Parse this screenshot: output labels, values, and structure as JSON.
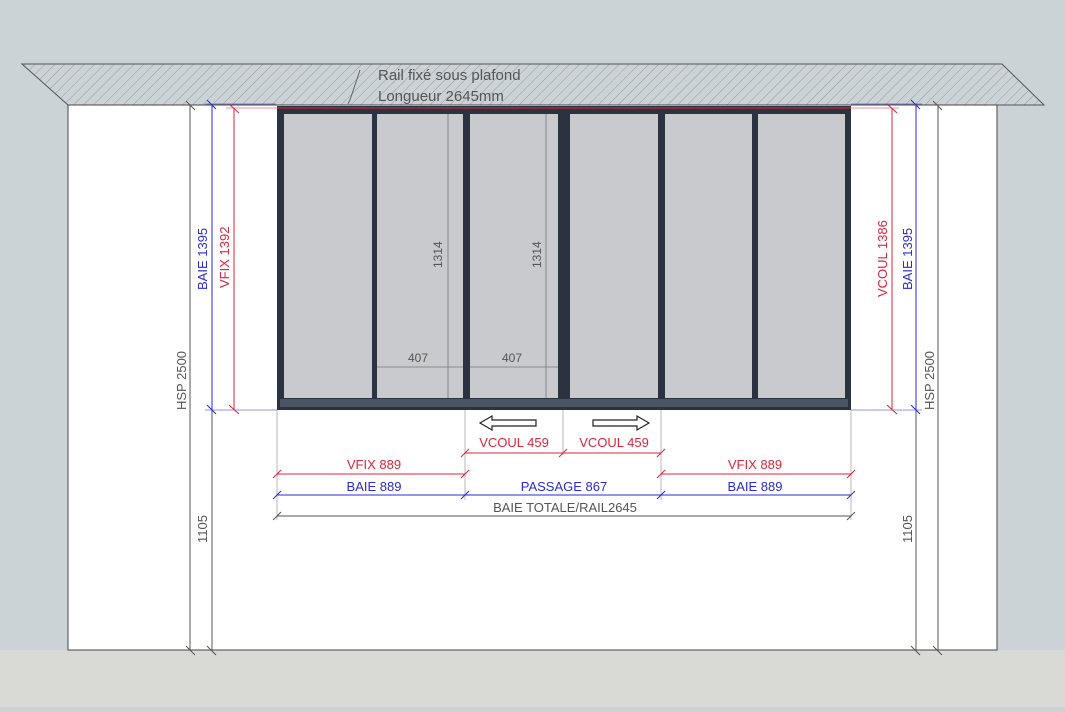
{
  "annotations": {
    "rail_line1": "Rail fixé sous plafond",
    "rail_line2": "Longueur 2645mm",
    "height_1314_a": "1314",
    "height_1314_b": "1314",
    "width_407_a": "407",
    "width_407_b": "407"
  },
  "left_side": {
    "baie": "BAIE 1395",
    "vfix": "VFIX 1392",
    "hsp": "HSP 2500",
    "sill": "1105"
  },
  "right_side": {
    "vcoul": "VCOUL 1386",
    "baie": "BAIE 1395",
    "hsp": "HSP 2500",
    "sill": "1105"
  },
  "bottom": {
    "vcoul_left": "VCOUL 459",
    "vcoul_right": "VCOUL 459",
    "vfix_left": "VFIX 889",
    "vfix_right": "VFIX 889",
    "baie_left": "BAIE 889",
    "passage": "PASSAGE 867",
    "baie_right": "BAIE 889",
    "total": "BAIE TOTALE/RAIL2645"
  },
  "colors": {
    "background": "#ccd3d6",
    "floor": "#d9d9d6",
    "wall": "#ffffff",
    "frame": "#2b3340",
    "glass": "#c9cacd",
    "red_dimension": "#e0243a",
    "blue_dimension": "#2a2ad6",
    "gray_dimension": "#555555"
  },
  "icons": {
    "arrow_left": "arrow-left-icon",
    "arrow_right": "arrow-right-icon"
  }
}
